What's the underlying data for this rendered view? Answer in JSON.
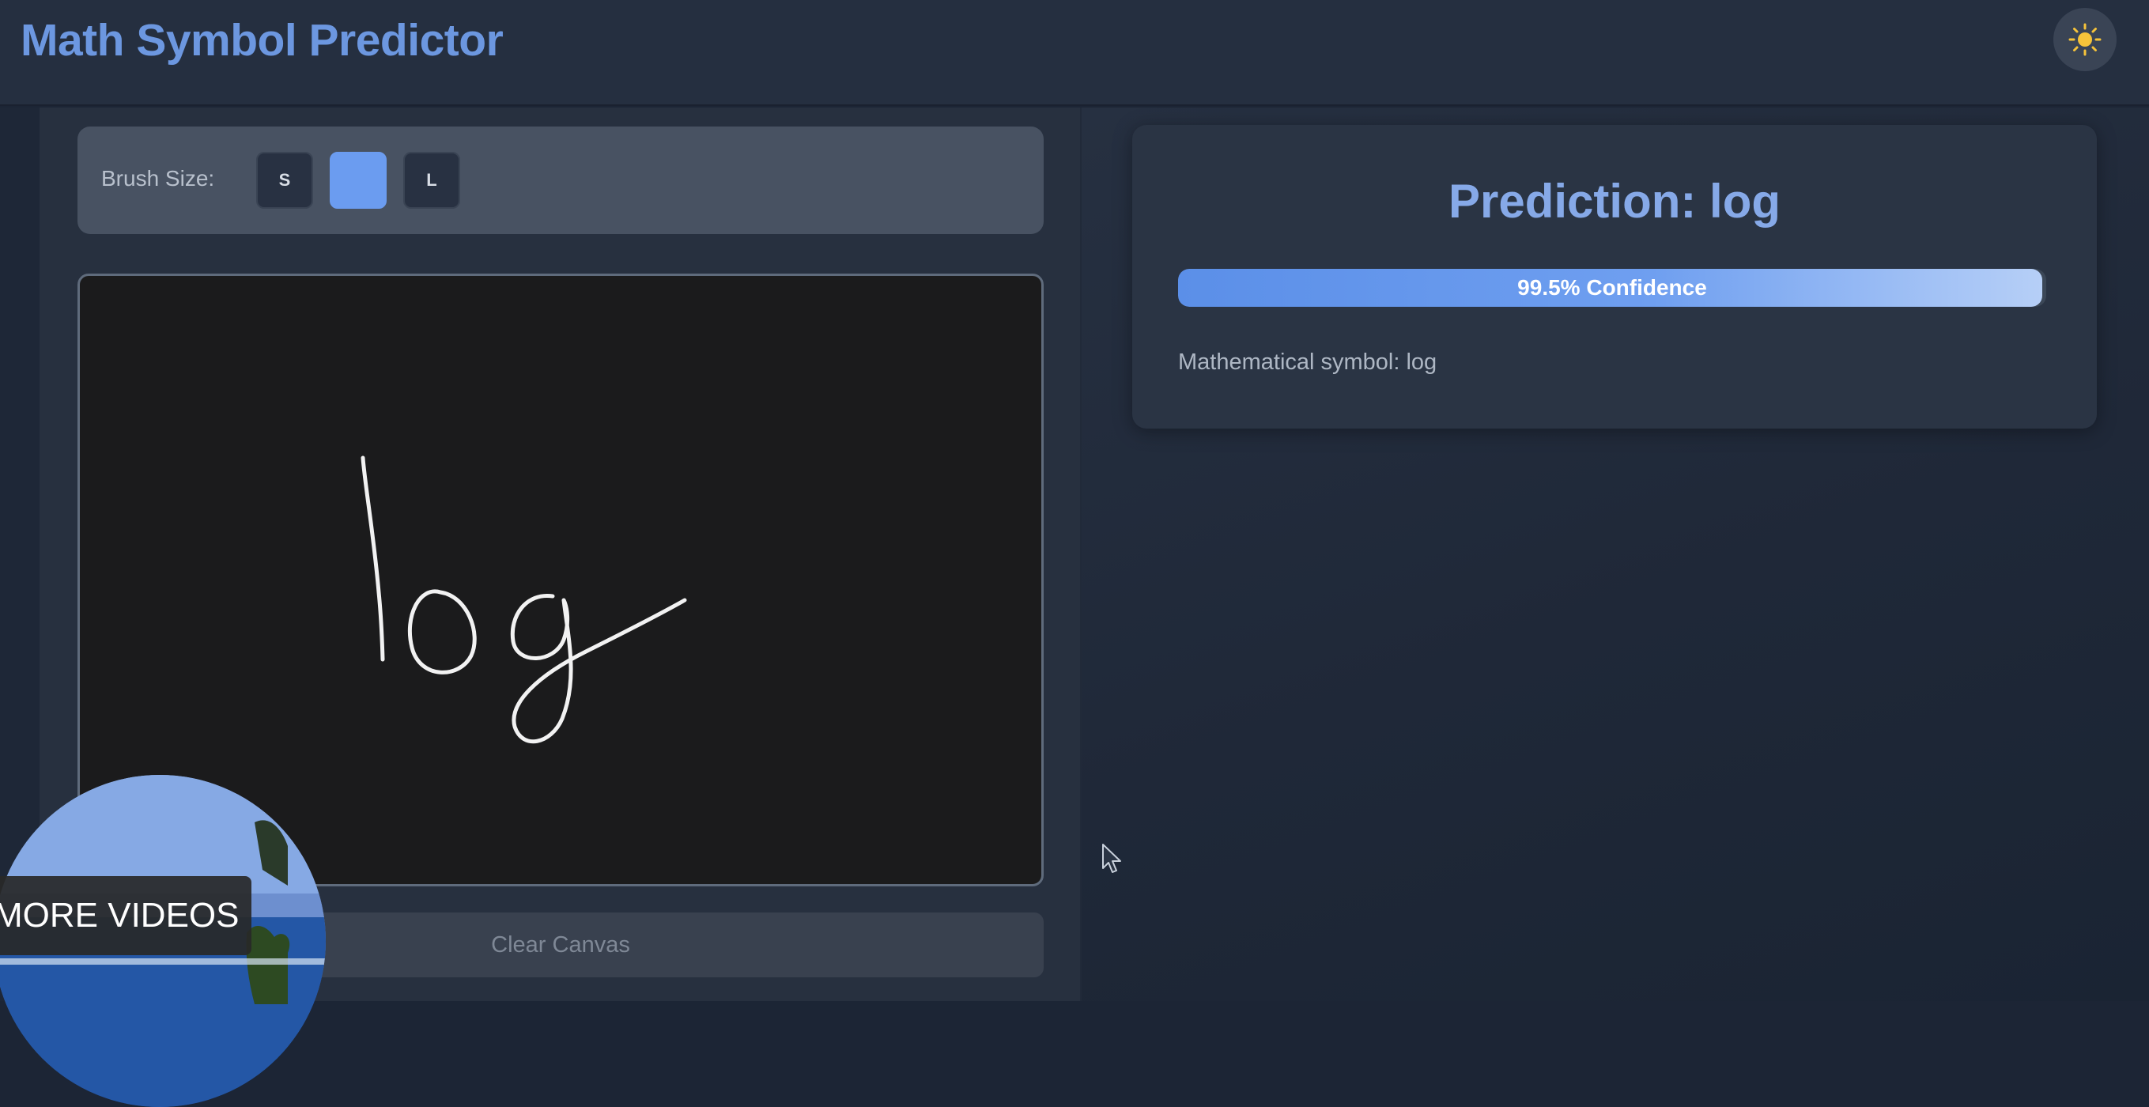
{
  "header": {
    "title": "Math Symbol Predictor",
    "theme_toggle_icon": "sun-icon"
  },
  "brush": {
    "label": "Brush Size:",
    "sizes": [
      {
        "label": "S",
        "active": false
      },
      {
        "label": "",
        "active": true
      },
      {
        "label": "L",
        "active": false
      }
    ]
  },
  "canvas": {
    "drawn_text": "log"
  },
  "actions": {
    "clear_label": "Clear Canvas"
  },
  "prediction": {
    "title": "Prediction: log",
    "confidence_label": "99.5% Confidence",
    "confidence_fraction": 0.995,
    "symbol_text": "Mathematical symbol: log"
  },
  "overlay": {
    "more_videos_label": "MORE VIDEOS"
  },
  "colors": {
    "accent": "#6b9cf0",
    "title": "#6c97e0",
    "background": "#1c2535"
  }
}
